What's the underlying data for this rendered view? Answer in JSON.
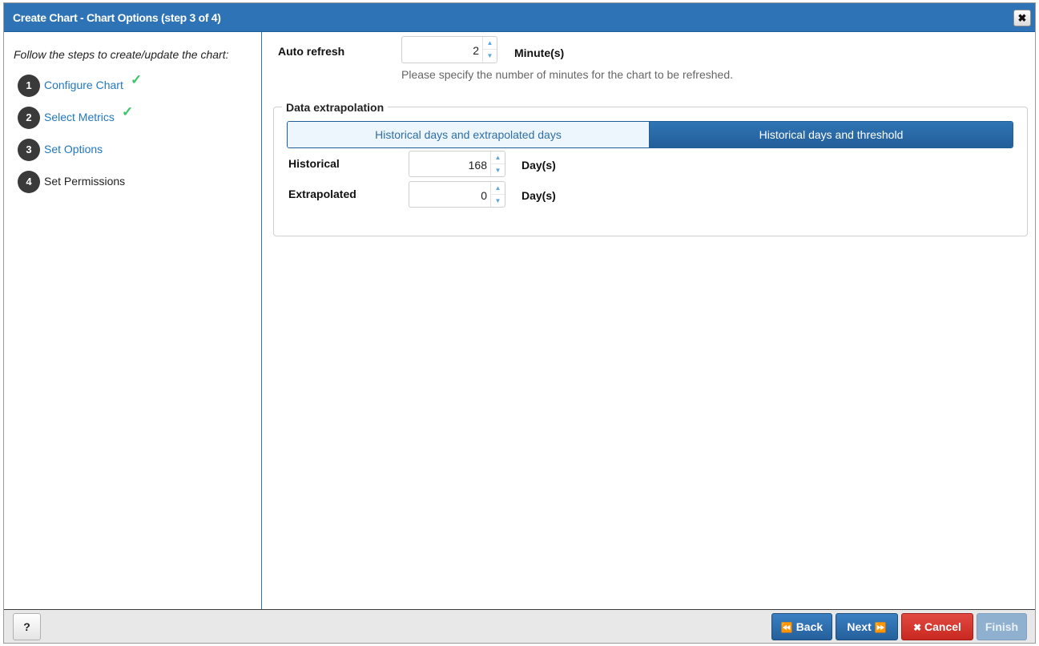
{
  "dialog": {
    "title": "Create Chart - Chart Options (step 3 of 4)",
    "close_symbol": "✖"
  },
  "sidebar": {
    "intro": "Follow the steps to create/update the chart:",
    "steps": [
      {
        "number": "1",
        "label": "Configure Chart",
        "check": "✓"
      },
      {
        "number": "2",
        "label": "Select Metrics",
        "check": "✓"
      },
      {
        "number": "3",
        "label": "Set Options"
      },
      {
        "number": "4",
        "label": "Set Permissions"
      }
    ]
  },
  "auto_refresh": {
    "label": "Auto refresh",
    "value": "2",
    "unit": "Minute(s)",
    "help": "Please specify the number of minutes for the chart to be refreshed."
  },
  "extrapolation": {
    "legend": "Data extrapolation",
    "tabs": [
      {
        "label": "Historical days and extrapolated days"
      },
      {
        "label": "Historical days and threshold"
      }
    ],
    "historical": {
      "label": "Historical",
      "value": "168",
      "unit": "Day(s)"
    },
    "extrapolated": {
      "label": "Extrapolated",
      "value": "0",
      "unit": "Day(s)"
    }
  },
  "footer": {
    "help": "?",
    "back": "Back",
    "back_icon": "⏪",
    "next": "Next",
    "next_icon": "⏩",
    "cancel": "Cancel",
    "cancel_icon": "✖",
    "finish": "Finish"
  },
  "colors": {
    "title_bar": "#2d73b5",
    "link": "#2277c0",
    "check": "#3cc46a",
    "cancel": "#c8281f",
    "finish_disabled": "#8fb0ce"
  },
  "icons": {
    "spinner_up": "▲",
    "spinner_down": "▼"
  }
}
